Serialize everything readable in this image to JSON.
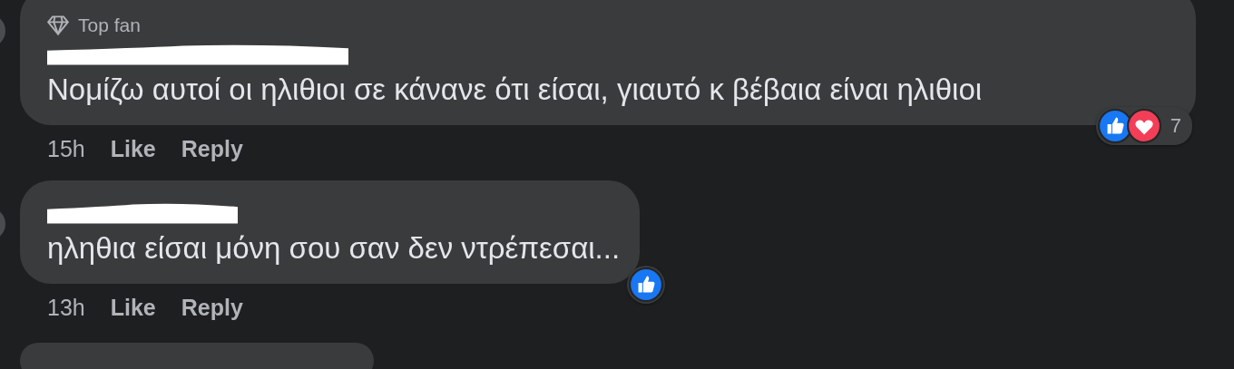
{
  "comments": [
    {
      "badge": "Top fan",
      "author_redacted": true,
      "text": "Νομίζω αυτοί οι ηλιθιοι σε κάνανε ότι είσαι, γιαυτό κ βέβαια είναι ηλιθιοι",
      "reactions": [
        {
          "kind": "like"
        },
        {
          "kind": "love"
        }
      ],
      "reaction_count": "7",
      "time": "15h",
      "actions": [
        "Like",
        "Reply"
      ]
    },
    {
      "author_redacted": true,
      "text": "ηληθια είσαι μόνη σου σαν δεν ντρέπεσαι...",
      "reactions": [
        {
          "kind": "like"
        }
      ],
      "time": "13h",
      "actions": [
        "Like",
        "Reply"
      ]
    }
  ]
}
